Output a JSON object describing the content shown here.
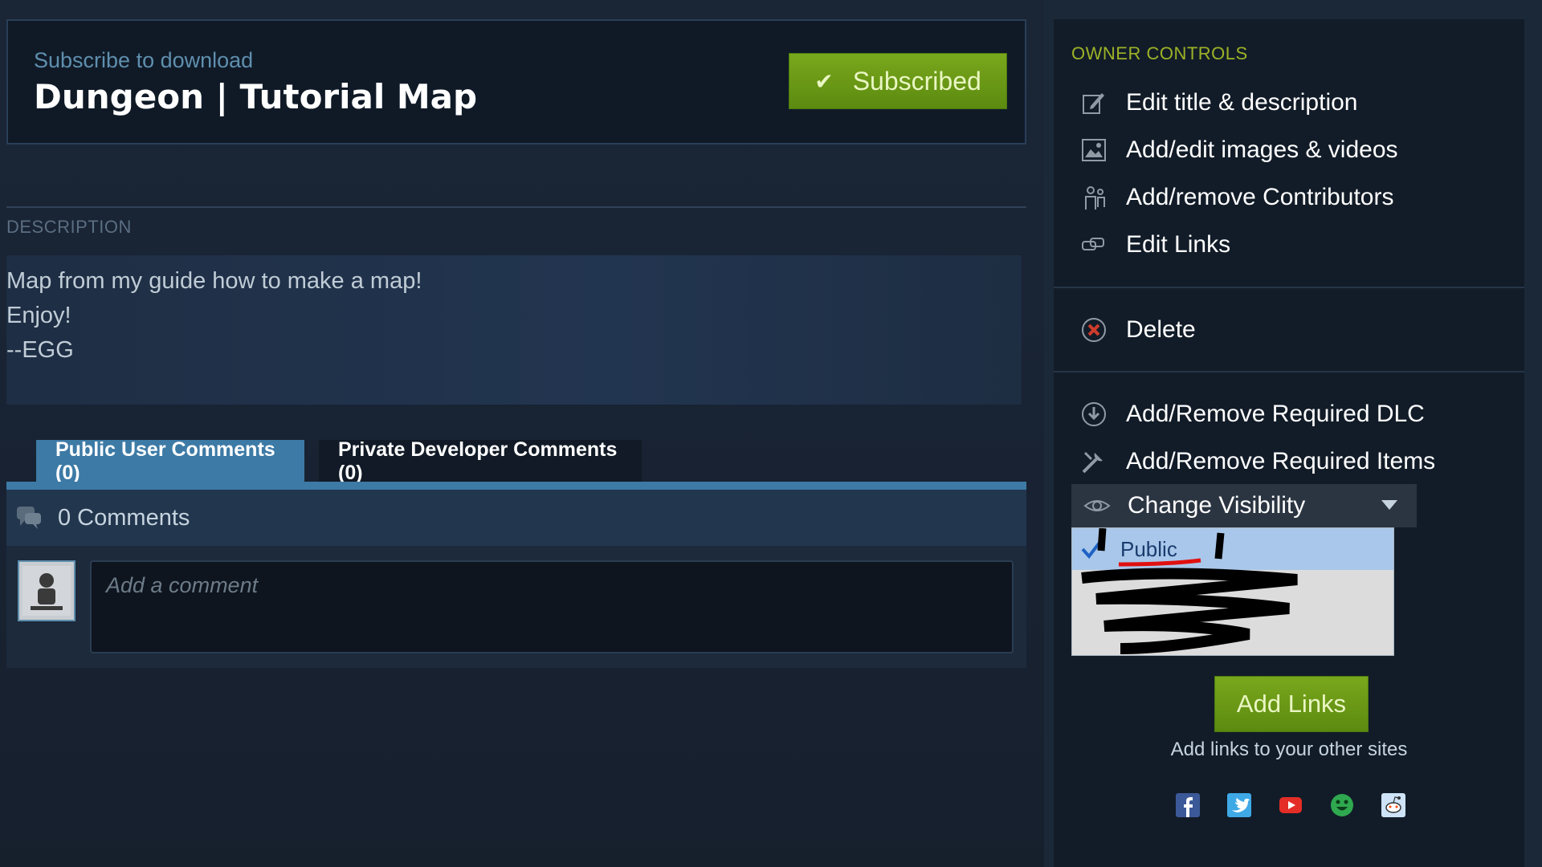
{
  "header": {
    "subscribe_label": "Subscribe to download",
    "title": "Dungeon | Tutorial Map",
    "subscribed_button": "Subscribed"
  },
  "description": {
    "heading": "DESCRIPTION",
    "lines": [
      "Map from my guide how to make a map!",
      "Enjoy!",
      "--EGG"
    ]
  },
  "tabs": [
    {
      "label": "Public User Comments (0)",
      "active": true
    },
    {
      "label": "Private Developer Comments (0)",
      "active": false
    }
  ],
  "comments": {
    "count_label": "0 Comments",
    "input_placeholder": "Add a comment"
  },
  "owner_controls": {
    "heading": "OWNER CONTROLS",
    "items": [
      {
        "label": "Edit title & description",
        "icon": "pencil-icon"
      },
      {
        "label": "Add/edit images & videos",
        "icon": "image-icon"
      },
      {
        "label": "Add/remove Contributors",
        "icon": "contributors-icon"
      },
      {
        "label": "Edit Links",
        "icon": "link-icon"
      },
      {
        "label": "Delete",
        "icon": "delete-icon"
      },
      {
        "label": "Add/Remove Required DLC",
        "icon": "dlc-icon"
      },
      {
        "label": "Add/Remove Required Items",
        "icon": "tools-icon"
      }
    ],
    "visibility": {
      "label": "Change Visibility",
      "selected_option": "Public"
    }
  },
  "links": {
    "add_button": "Add Links",
    "hint": "Add links to your other sites",
    "social_icons": [
      "facebook-icon",
      "twitter-icon",
      "youtube-icon",
      "smiley-icon",
      "reddit-icon"
    ]
  },
  "colors": {
    "accent_green": "#79a71c",
    "tab_blue": "#3d7aa6",
    "owner_heading": "#9db227"
  }
}
